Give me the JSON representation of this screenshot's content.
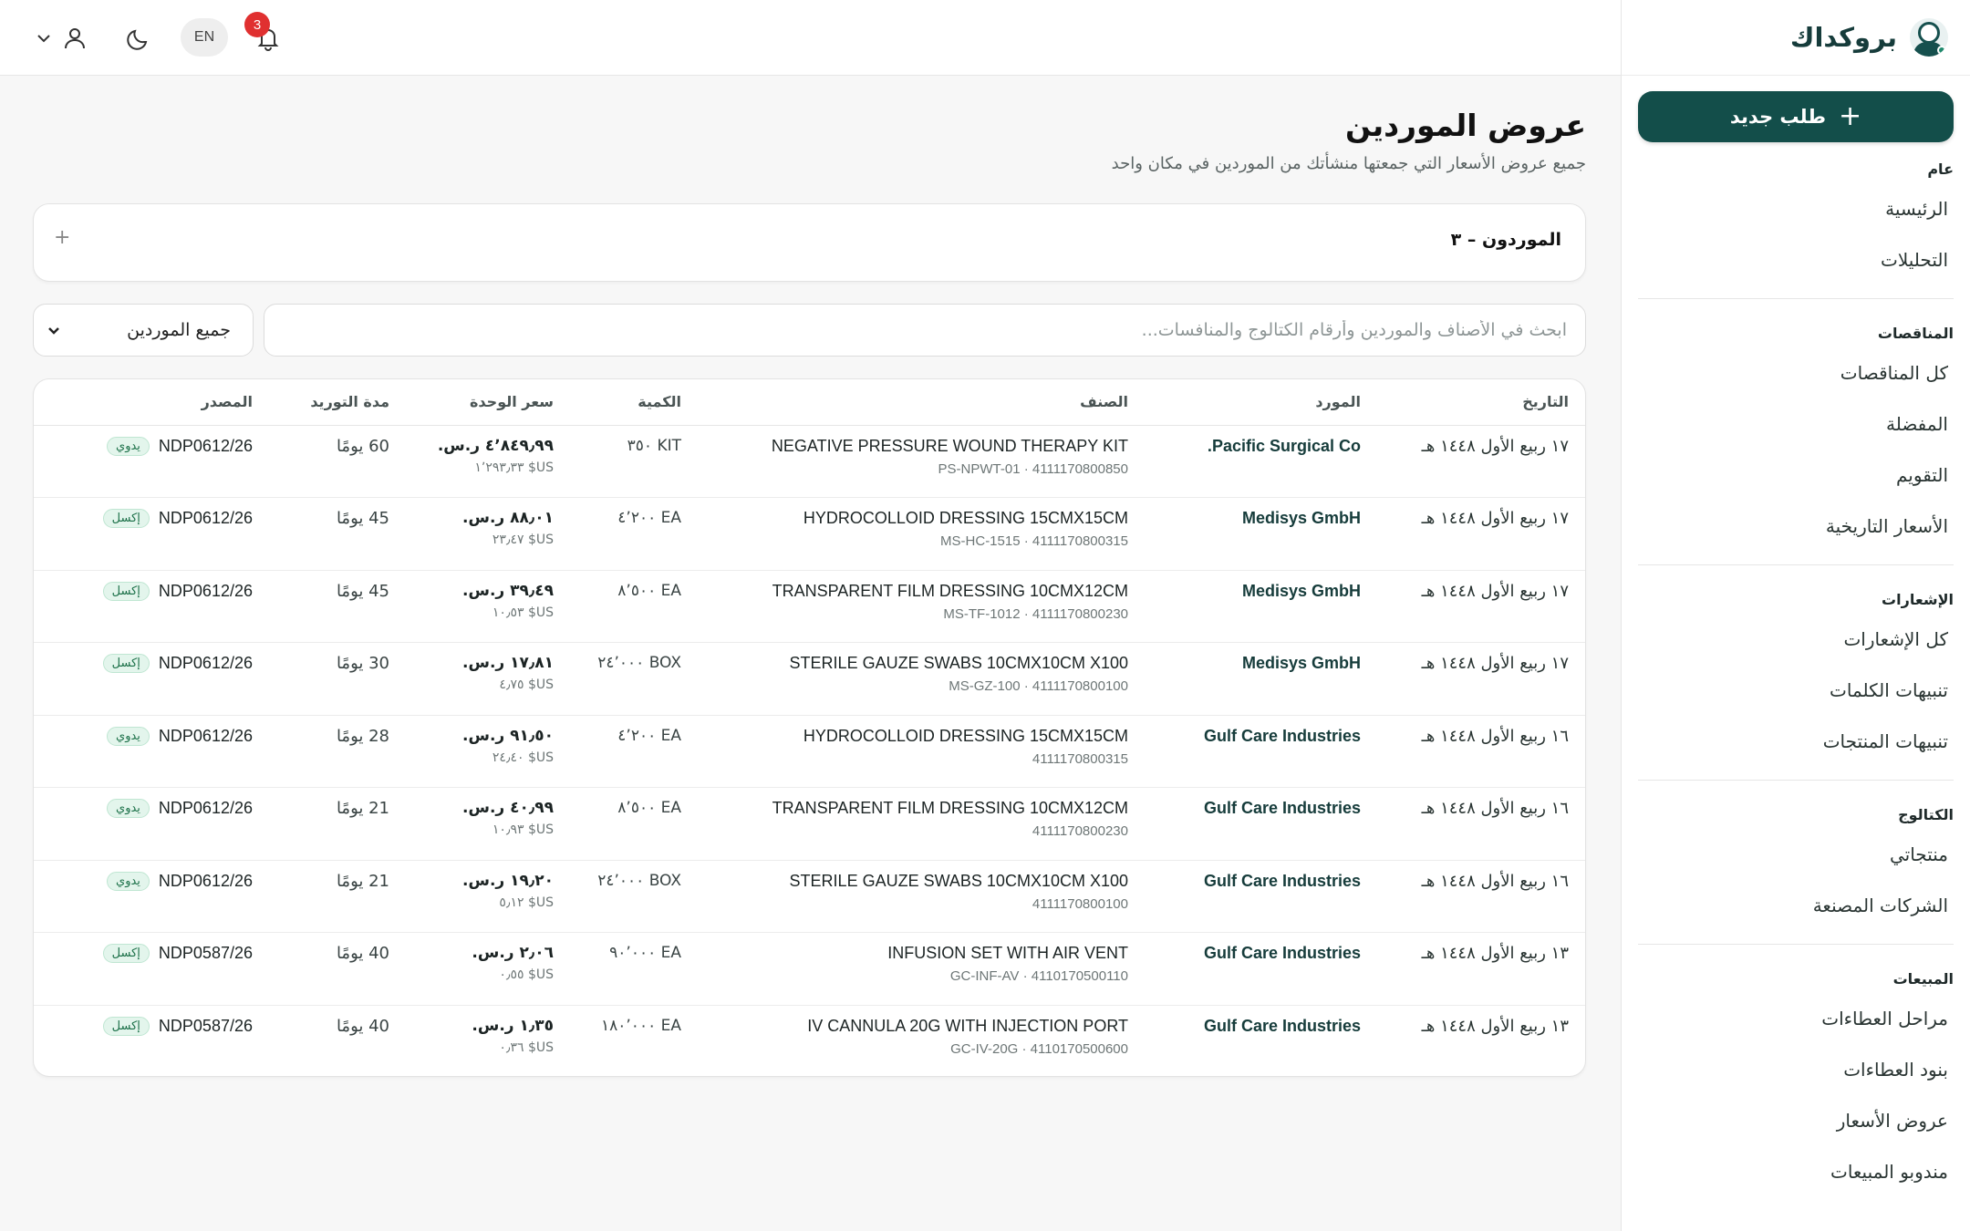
{
  "brand": {
    "name": "بروكداك"
  },
  "topbar": {
    "lang": "EN",
    "notifications": "3"
  },
  "sidebar": {
    "new_button": "طلب جديد",
    "sections": [
      {
        "title": "عام",
        "items": [
          "الرئيسية",
          "التحليلات"
        ]
      },
      {
        "title": "المناقصات",
        "items": [
          "كل المناقصات",
          "المفضلة",
          "التقويم",
          "الأسعار التاريخية"
        ]
      },
      {
        "title": "الإشعارات",
        "items": [
          "كل الإشعارات",
          "تنبيهات الكلمات",
          "تنبيهات المنتجات"
        ]
      },
      {
        "title": "الكتالوج",
        "items": [
          "منتجاتي",
          "الشركات المصنعة"
        ]
      },
      {
        "title": "المبيعات",
        "items": [
          "مراحل العطاءات",
          "بنود العطاءات",
          "عروض الأسعار",
          "مندوبو المبيعات"
        ]
      }
    ]
  },
  "page": {
    "title": "عروض الموردين",
    "subtitle": "جميع عروض الأسعار التي جمعتها منشأتك من الموردين في مكان واحد",
    "suppliers_label": "الموردون – ٣",
    "search_placeholder": "ابحث في الأصناف والموردين وأرقام الكتالوج والمنافسات...",
    "filter_value": "جميع الموردين"
  },
  "table": {
    "headers": {
      "date": "التاريخ",
      "supplier": "المورد",
      "item": "الصنف",
      "qty": "الكمية",
      "price": "سعر الوحدة",
      "lead": "مدة التوريد",
      "source": "المصدر"
    },
    "rows": [
      {
        "date": "١٧ ربيع الأول ١٤٤٨ هـ",
        "supplier": "Pacific Surgical Co.",
        "item": "NEGATIVE PRESSURE WOUND THERAPY KIT",
        "code": "PS-NPWT-01 · 4111170800850",
        "qty": "KIT ٣٥٠",
        "price": "٤٬٨٤٩٫٩٩ ر.س.",
        "price_usd": "US$ ١٬٢٩٣٫٣٣",
        "lead": "60 يومًا",
        "tag": "يدوي",
        "source": "NDP0612/26"
      },
      {
        "date": "١٧ ربيع الأول ١٤٤٨ هـ",
        "supplier": "Medisys GmbH",
        "item": "HYDROCOLLOID DRESSING 15CMX15CM",
        "code": "MS-HC-1515 · 4111170800315",
        "qty": "EA ٤٬٢٠٠",
        "price": "٨٨٫٠١ ر.س.",
        "price_usd": "US$ ٢٣٫٤٧",
        "lead": "45 يومًا",
        "tag": "إكسل",
        "source": "NDP0612/26"
      },
      {
        "date": "١٧ ربيع الأول ١٤٤٨ هـ",
        "supplier": "Medisys GmbH",
        "item": "TRANSPARENT FILM DRESSING 10CMX12CM",
        "code": "MS-TF-1012 · 4111170800230",
        "qty": "EA ٨٬٥٠٠",
        "price": "٣٩٫٤٩ ر.س.",
        "price_usd": "US$ ١٠٫٥٣",
        "lead": "45 يومًا",
        "tag": "إكسل",
        "source": "NDP0612/26"
      },
      {
        "date": "١٧ ربيع الأول ١٤٤٨ هـ",
        "supplier": "Medisys GmbH",
        "item": "STERILE GAUZE SWABS 10CMX10CM X100",
        "code": "MS-GZ-100 · 4111170800100",
        "qty": "BOX ٢٤٬٠٠٠",
        "price": "١٧٫٨١ ر.س.",
        "price_usd": "US$ ٤٫٧٥",
        "lead": "30 يومًا",
        "tag": "إكسل",
        "source": "NDP0612/26"
      },
      {
        "date": "١٦ ربيع الأول ١٤٤٨ هـ",
        "supplier": "Gulf Care Industries",
        "item": "HYDROCOLLOID DRESSING 15CMX15CM",
        "code": "4111170800315",
        "qty": "EA ٤٬٢٠٠",
        "price": "٩١٫٥٠ ر.س.",
        "price_usd": "US$ ٢٤٫٤٠",
        "lead": "28 يومًا",
        "tag": "يدوي",
        "source": "NDP0612/26"
      },
      {
        "date": "١٦ ربيع الأول ١٤٤٨ هـ",
        "supplier": "Gulf Care Industries",
        "item": "TRANSPARENT FILM DRESSING 10CMX12CM",
        "code": "4111170800230",
        "qty": "EA ٨٬٥٠٠",
        "price": "٤٠٫٩٩ ر.س.",
        "price_usd": "US$ ١٠٫٩٣",
        "lead": "21 يومًا",
        "tag": "يدوي",
        "source": "NDP0612/26"
      },
      {
        "date": "١٦ ربيع الأول ١٤٤٨ هـ",
        "supplier": "Gulf Care Industries",
        "item": "STERILE GAUZE SWABS 10CMX10CM X100",
        "code": "4111170800100",
        "qty": "BOX ٢٤٬٠٠٠",
        "price": "١٩٫٢٠ ر.س.",
        "price_usd": "US$ ٥٫١٢",
        "lead": "21 يومًا",
        "tag": "يدوي",
        "source": "NDP0612/26"
      },
      {
        "date": "١٣ ربيع الأول ١٤٤٨ هـ",
        "supplier": "Gulf Care Industries",
        "item": "INFUSION SET WITH AIR VENT",
        "code": "GC-INF-AV · 4110170500110",
        "qty": "EA ٩٠٬٠٠٠",
        "price": "٢٫٠٦ ر.س.",
        "price_usd": "US$ ٠٫٥٥",
        "lead": "40 يومًا",
        "tag": "إكسل",
        "source": "NDP0587/26"
      },
      {
        "date": "١٣ ربيع الأول ١٤٤٨ هـ",
        "supplier": "Gulf Care Industries",
        "item": "IV CANNULA 20G WITH INJECTION PORT",
        "code": "GC-IV-20G · 4110170500600",
        "qty": "EA ١٨٠٬٠٠٠",
        "price": "١٫٣٥ ر.س.",
        "price_usd": "US$ ٠٫٣٦",
        "lead": "40 يومًا",
        "tag": "إكسل",
        "source": "NDP0587/26"
      }
    ]
  },
  "colors": {
    "accent": "#134e4a",
    "badge": "#e03030",
    "tag_bg": "#e3f5ec",
    "tag_fg": "#1b7048"
  },
  "icons": [
    "bell-icon",
    "moon-icon",
    "user-icon",
    "chevron-down-icon",
    "plus-icon",
    "brand-logo"
  ]
}
